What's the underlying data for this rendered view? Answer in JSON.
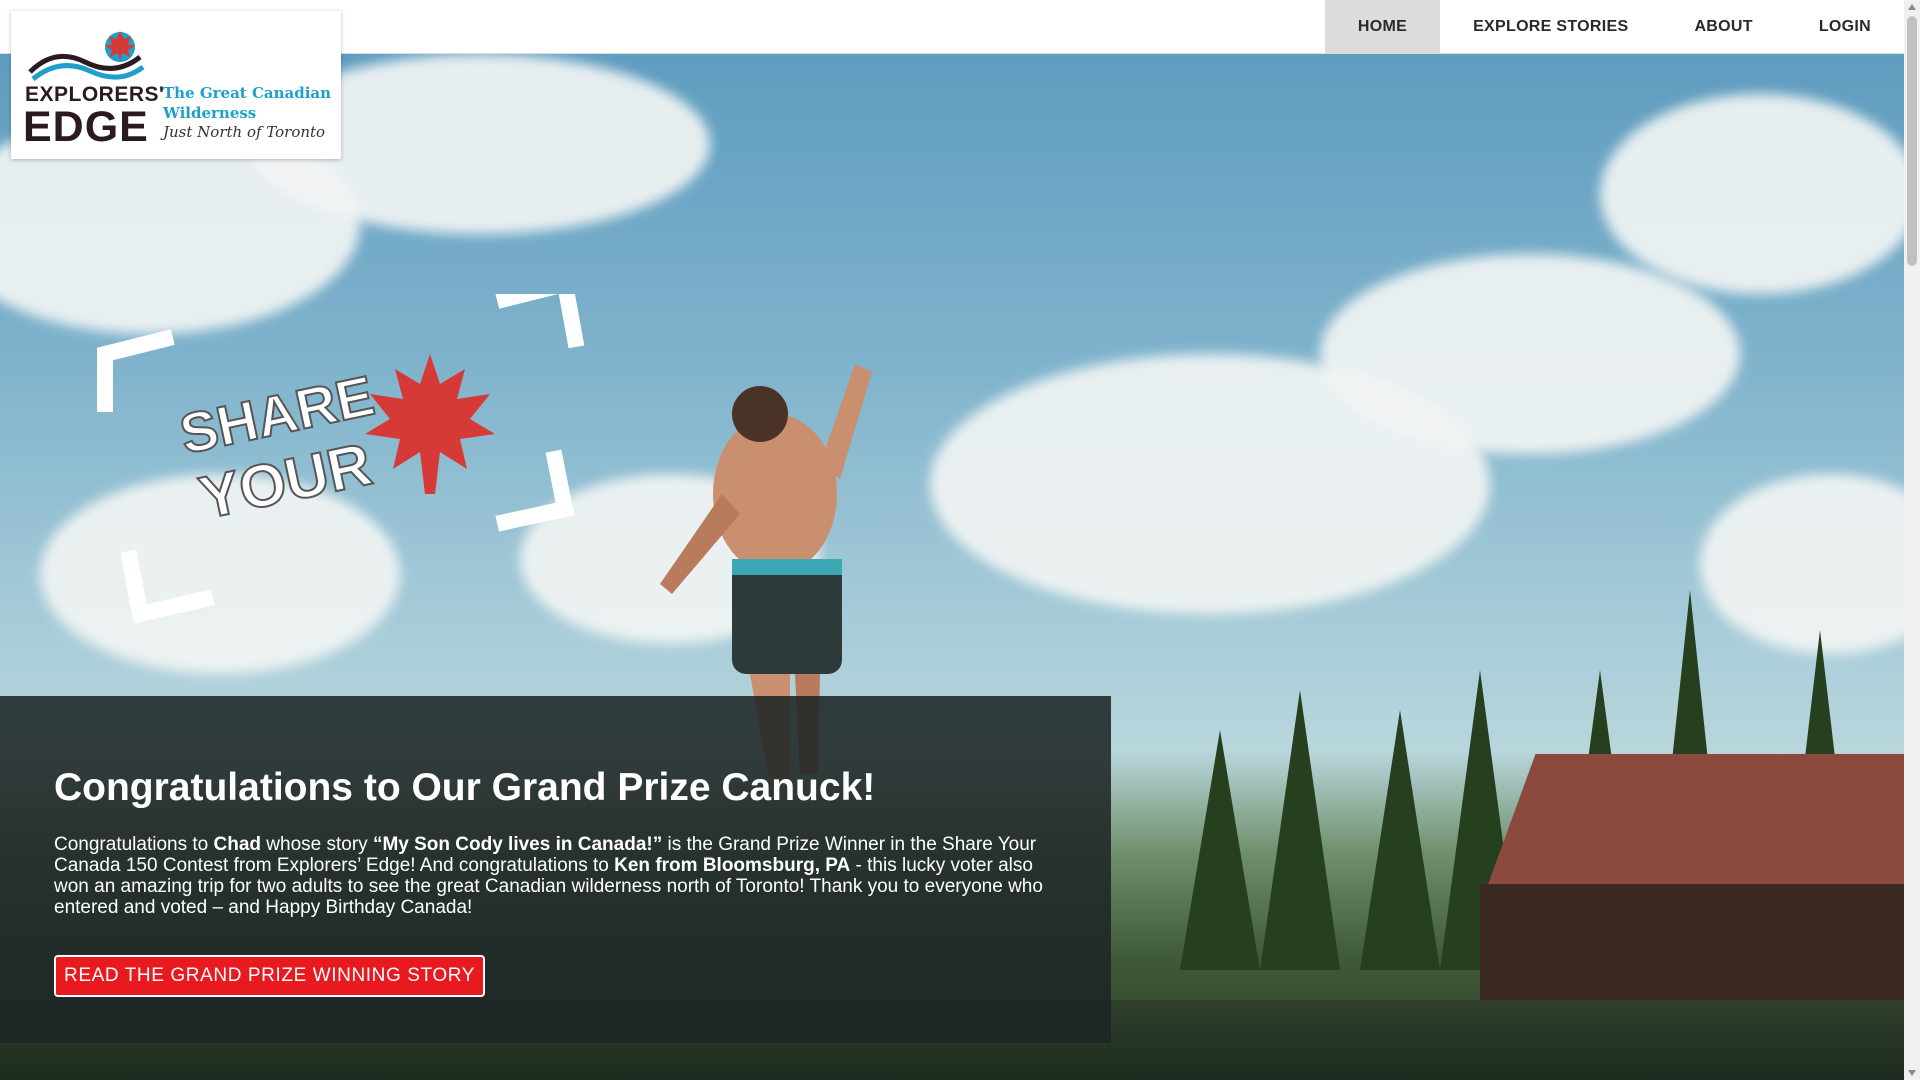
{
  "brand": {
    "name_line1": "EXPLORERS'",
    "name_line2": "EDGE",
    "tagline": "The Great Canadian Wilderness",
    "subtagline": "Just North of Toronto"
  },
  "nav": {
    "items": [
      {
        "label": "HOME",
        "active": true
      },
      {
        "label": "EXPLORE STORIES",
        "active": false
      },
      {
        "label": "ABOUT",
        "active": false
      },
      {
        "label": "LOGIN",
        "active": false
      }
    ]
  },
  "hero": {
    "graphic_text_line1": "SHARE",
    "graphic_text_line2": "YOUR"
  },
  "panel": {
    "heading": "Congratulations to Our Grand Prize Canuck!",
    "body": {
      "t1": "Congratulations to ",
      "b1": "Chad",
      "t2": " whose story ",
      "b2": "“My Son Cody lives in Canada!”",
      "t3": " is the Grand Prize Winner in the Share Your Canada 150 Contest from Explorers’ Edge! And congratulations to ",
      "b3": "Ken from Bloomsburg, PA",
      "t4": " - this lucky voter also won an amazing trip for two adults to see the great Canadian wilderness north of Toronto! Thank you to everyone who entered and voted – and Happy Birthday Canada!"
    },
    "cta_label": "READ THE GRAND PRIZE WINNING STORY"
  },
  "colors": {
    "accent_red": "#e8191f",
    "brand_blue": "#1fa0c9",
    "brand_dark": "#2b1a1f",
    "nav_active_bg": "#dcdcdc"
  }
}
